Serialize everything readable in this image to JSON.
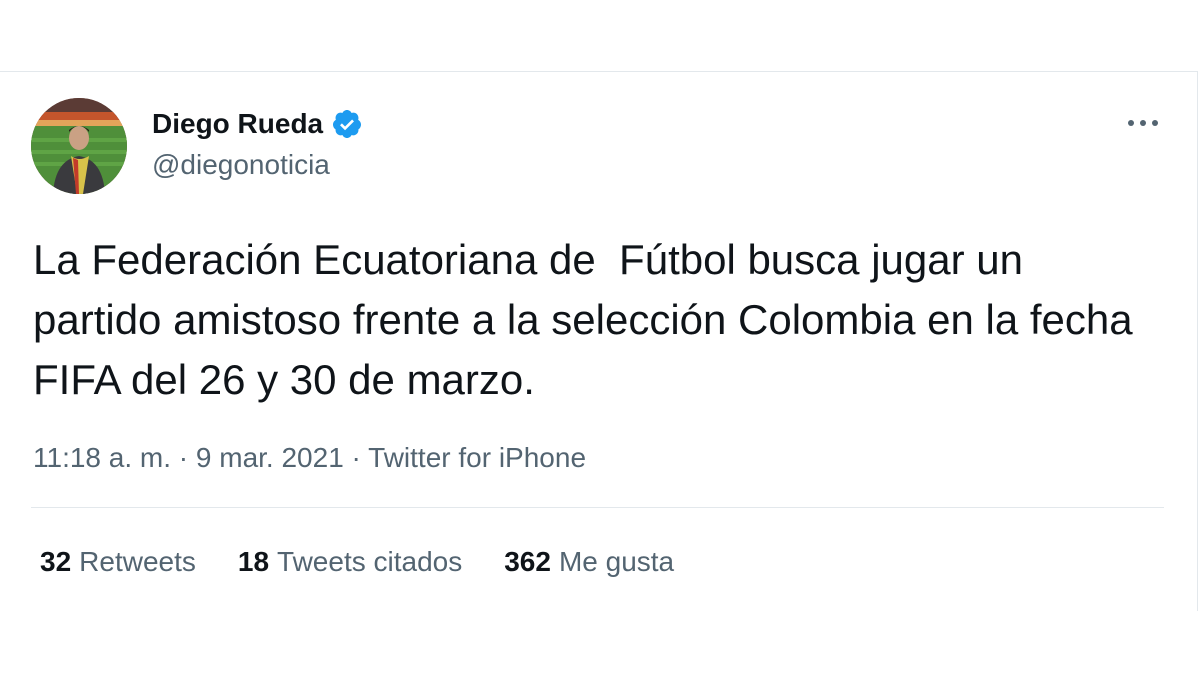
{
  "tweet": {
    "author_name": "Diego Rueda",
    "author_handle": "@diegonoticia",
    "text": "La Federación Ecuatoriana de  Fútbol busca jugar un partido amistoso frente a la selección Colombia en la fecha FIFA del 26 y 30 de marzo.",
    "meta": "11:18 a. m. · 9 mar. 2021 · Twitter for iPhone"
  },
  "stats": [
    {
      "count": "32",
      "label": "Retweets"
    },
    {
      "count": "18",
      "label": "Tweets citados"
    },
    {
      "count": "362",
      "label": "Me gusta"
    }
  ],
  "icons": {
    "verified": "verified-badge-icon",
    "more": "more-options-icon"
  },
  "colors": {
    "text_primary": "#0f1419",
    "text_secondary": "#536471",
    "verified_blue": "#1d9bf0",
    "border": "#e3e8ec"
  }
}
